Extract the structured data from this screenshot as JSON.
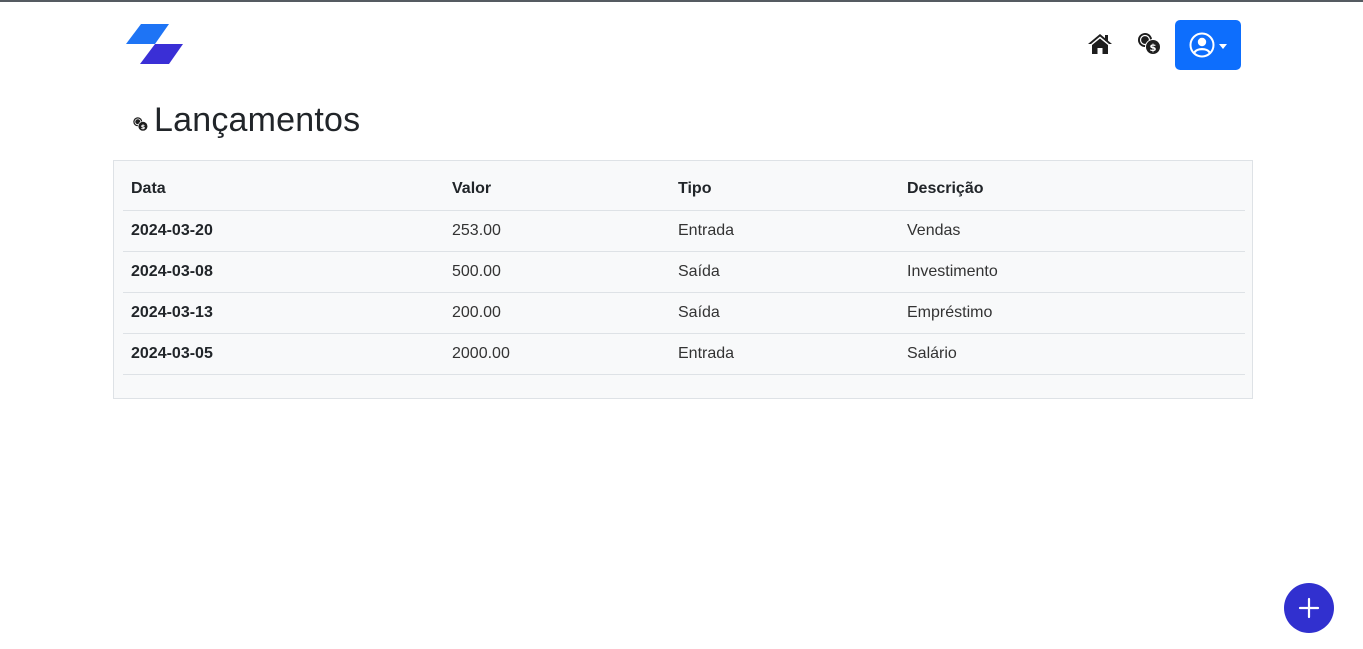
{
  "header": {
    "logo_icon": "parallelogram-logo-icon",
    "nav": {
      "home_icon": "home-icon",
      "coins_icon": "coins-icon",
      "user_icon": "user-circle-icon",
      "user_button_color": "#0d6efd"
    }
  },
  "page": {
    "title": "Lançamentos",
    "title_icon": "coins-icon"
  },
  "table": {
    "headers": [
      "Data",
      "Valor",
      "Tipo",
      "Descrição"
    ],
    "rows": [
      {
        "data": "2024-03-20",
        "valor": "253.00",
        "tipo": "Entrada",
        "descricao": "Vendas"
      },
      {
        "data": "2024-03-08",
        "valor": "500.00",
        "tipo": "Saída",
        "descricao": "Investimento"
      },
      {
        "data": "2024-03-13",
        "valor": "200.00",
        "tipo": "Saída",
        "descricao": "Empréstimo"
      },
      {
        "data": "2024-03-05",
        "valor": "2000.00",
        "tipo": "Entrada",
        "descricao": "Salário"
      }
    ]
  },
  "fab": {
    "icon": "plus-icon",
    "color": "#3130cf"
  },
  "colors": {
    "primary": "#0d6efd",
    "logo_light": "#1e74f5",
    "logo_dark": "#3a2fd6",
    "accent": "#3130cf"
  }
}
